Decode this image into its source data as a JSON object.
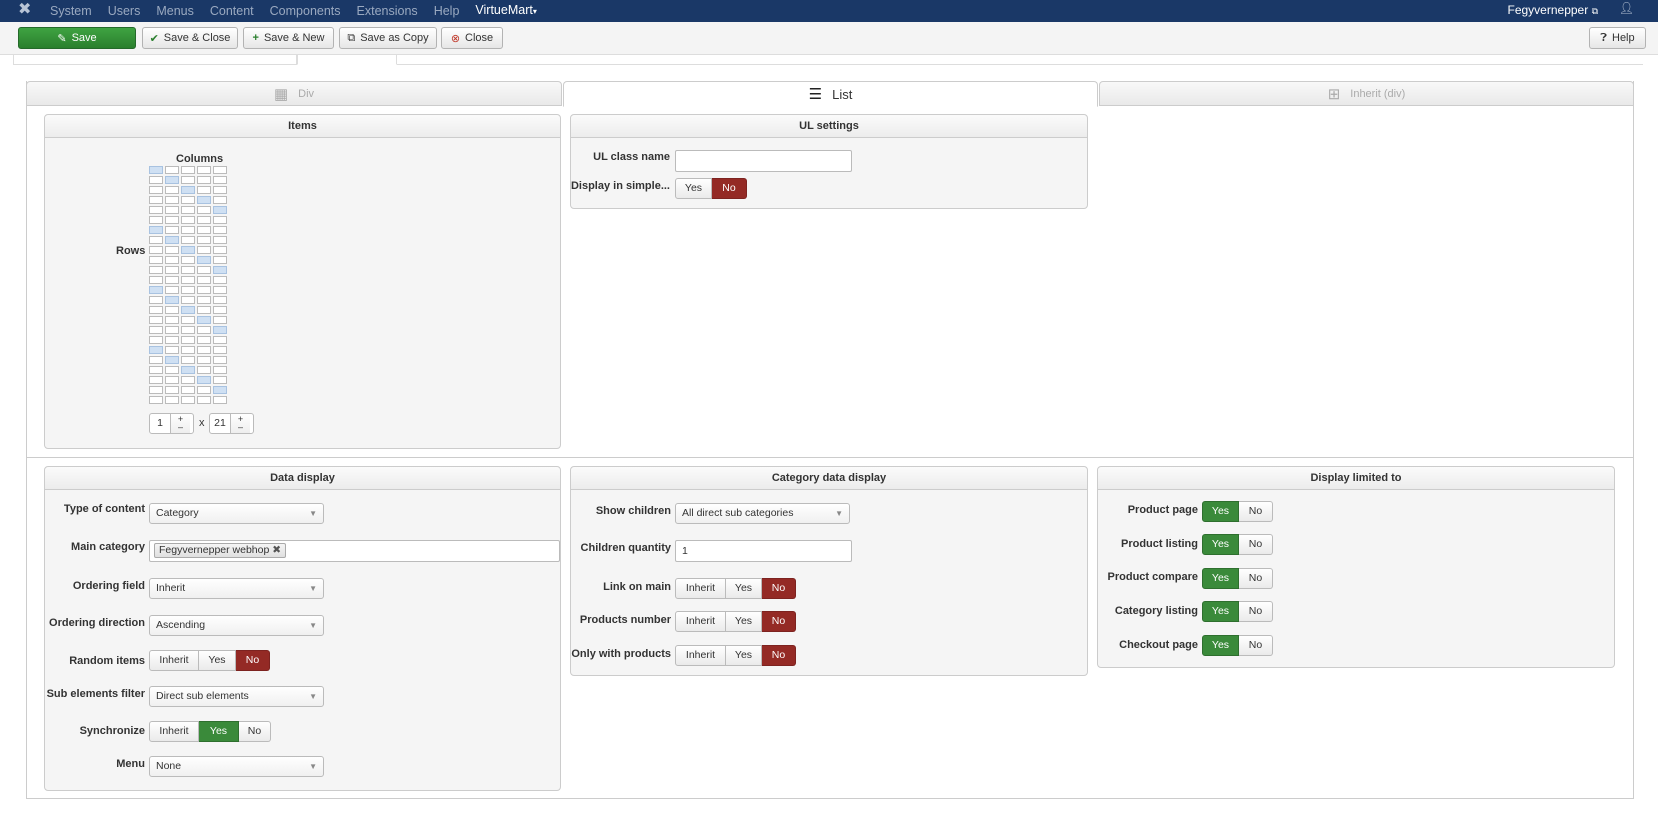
{
  "navbar": {
    "menu": [
      "System",
      "Users",
      "Menus",
      "Content",
      "Components",
      "Extensions",
      "Help"
    ],
    "active": "VirtueMart",
    "user": "Fegyvernepper"
  },
  "toolbar": {
    "save": "Save",
    "save_close": "Save & Close",
    "save_new": "Save & New",
    "save_copy": "Save as Copy",
    "close": "Close",
    "help": "Help"
  },
  "layout_tabs": {
    "div": "Div",
    "list": "List",
    "inherit": "Inherit (div)"
  },
  "items_panel": {
    "title": "Items",
    "columns_label": "Columns",
    "rows_label": "Rows",
    "columns_value": "1",
    "times": "x",
    "rows_value": "21",
    "plus": "+",
    "minus": "–"
  },
  "ul_panel": {
    "title": "UL settings",
    "class_label": "UL class name",
    "class_value": "",
    "simple_label": "Display in simple...",
    "yes": "Yes",
    "no": "No"
  },
  "data_display": {
    "title": "Data display",
    "type_label": "Type of content",
    "type_value": "Category",
    "main_cat_label": "Main category",
    "main_cat_value": "Fegyvernepper webhop",
    "ordering_label": "Ordering field",
    "ordering_value": "Inherit",
    "direction_label": "Ordering direction",
    "direction_value": "Ascending",
    "random_label": "Random items",
    "subfilter_label": "Sub elements filter",
    "subfilter_value": "Direct sub elements",
    "sync_label": "Synchronize",
    "menu_label": "Menu",
    "menu_value": "None",
    "inherit": "Inherit",
    "yes": "Yes",
    "no": "No"
  },
  "category_display": {
    "title": "Category data display",
    "children_label": "Show children",
    "children_value": "All direct sub categories",
    "qty_label": "Children quantity",
    "qty_value": "1",
    "link_label": "Link on main",
    "products_label": "Products number",
    "only_label": "Only with products",
    "inherit": "Inherit",
    "yes": "Yes",
    "no": "No"
  },
  "limited": {
    "title": "Display limited to",
    "product_page": "Product page",
    "product_listing": "Product listing",
    "product_compare": "Product compare",
    "category_listing": "Category listing",
    "checkout_page": "Checkout page",
    "yes": "Yes",
    "no": "No"
  },
  "colors": {
    "navbar": "#1a3867",
    "save": "#2f8f33",
    "no_active": "#942a25",
    "yes_active": "#3a8a3a"
  }
}
